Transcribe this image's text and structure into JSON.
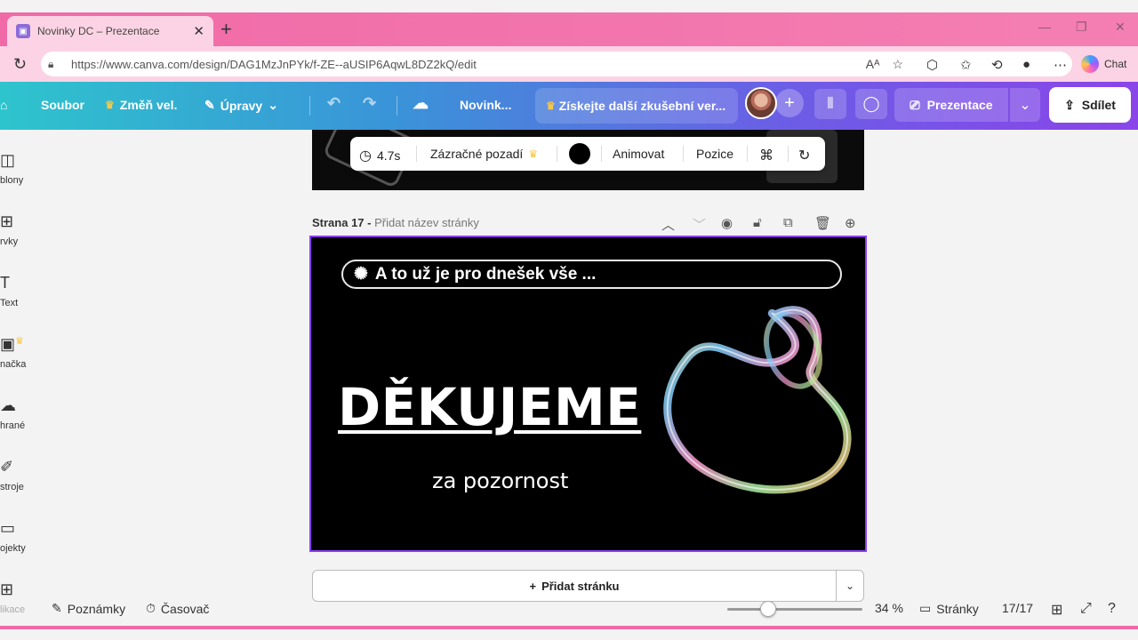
{
  "browser": {
    "tab_title": "Novinky DC – Prezentace",
    "url": "https://www.canva.com/design/DAG1MzJnPYk/f-ZE--aUSIP6AqwL8DZ2kQ/edit",
    "chat_label": "Chat"
  },
  "toolbar": {
    "file_label": "Soubor",
    "resize_label": "Změň vel.",
    "edit_label": "Úpravy",
    "title_label": "Novink...",
    "trial_label": "Získejte další zkušební ver...",
    "present_label": "Prezentace",
    "share_label": "Sdílet"
  },
  "sidebar": {
    "items": [
      {
        "label": "blony",
        "icon": "template-icon"
      },
      {
        "label": "rvky",
        "icon": "elements-icon"
      },
      {
        "label": "Text",
        "icon": "text-icon"
      },
      {
        "label": "načka",
        "icon": "brand-icon"
      },
      {
        "label": "hrané",
        "icon": "uploads-icon"
      },
      {
        "label": "stroje",
        "icon": "draw-icon"
      },
      {
        "label": "ojekty",
        "icon": "projects-icon"
      },
      {
        "label": "likace",
        "icon": "apps-icon"
      }
    ]
  },
  "floatbar": {
    "duration": "4.7s",
    "magic_bg": "Zázračné pozadí",
    "animate": "Animovat",
    "position": "Pozice"
  },
  "page": {
    "label": "Strana 17 -",
    "placeholder": "Přidat název stránky"
  },
  "slide": {
    "pill_text": "A to už je pro dnešek vše ...",
    "title": "DĚKUJEME",
    "subtitle": "za pozornost"
  },
  "add_page_label": "Přidat stránku",
  "bottom": {
    "notes": "Poznámky",
    "timer": "Časovač",
    "zoom": "34 %",
    "zoom_fraction": 0.3,
    "pages_label": "Stránky",
    "page_count": "17/17"
  },
  "colors": {
    "accent": "#8b3dff",
    "browser_pink": "#f06aa7",
    "toolbar_start": "#2ec4cd",
    "toolbar_end": "#8a45e8"
  }
}
